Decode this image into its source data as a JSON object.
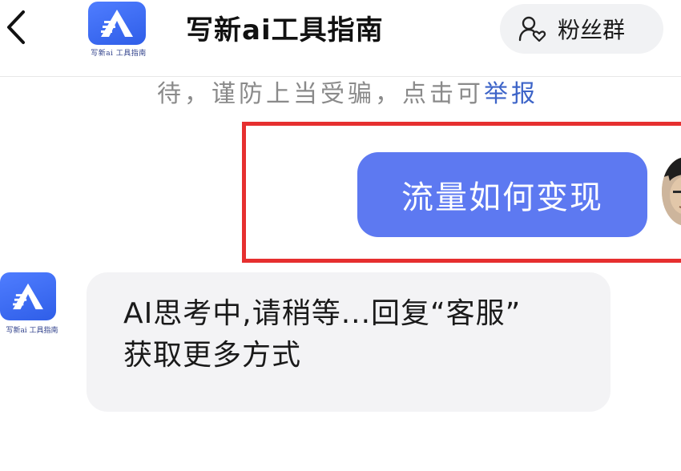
{
  "header": {
    "back_icon": "chevron-left-icon",
    "logo_caption": "写新ai 工具指南",
    "title": "写新ai工具指南",
    "fans_button": {
      "icon": "user-heart-icon",
      "label": "粉丝群"
    }
  },
  "notice": {
    "text": "待，谨防上当受骗，点击可",
    "link": "举报"
  },
  "messages": [
    {
      "from": "user",
      "text": "流量如何变现",
      "highlighted": true,
      "bubble_color": "#5d79f1"
    },
    {
      "from": "bot",
      "lines": [
        "AI思考中,请稍等...回复“客服”",
        "获取更多方式"
      ],
      "avatar_caption": "写新ai 工具指南",
      "bubble_color": "#f3f3f5"
    }
  ],
  "colors": {
    "accent": "#5d79f1",
    "highlight_border": "#e62f2f",
    "link": "#3d64c8",
    "brand": "#3b6cf5"
  }
}
